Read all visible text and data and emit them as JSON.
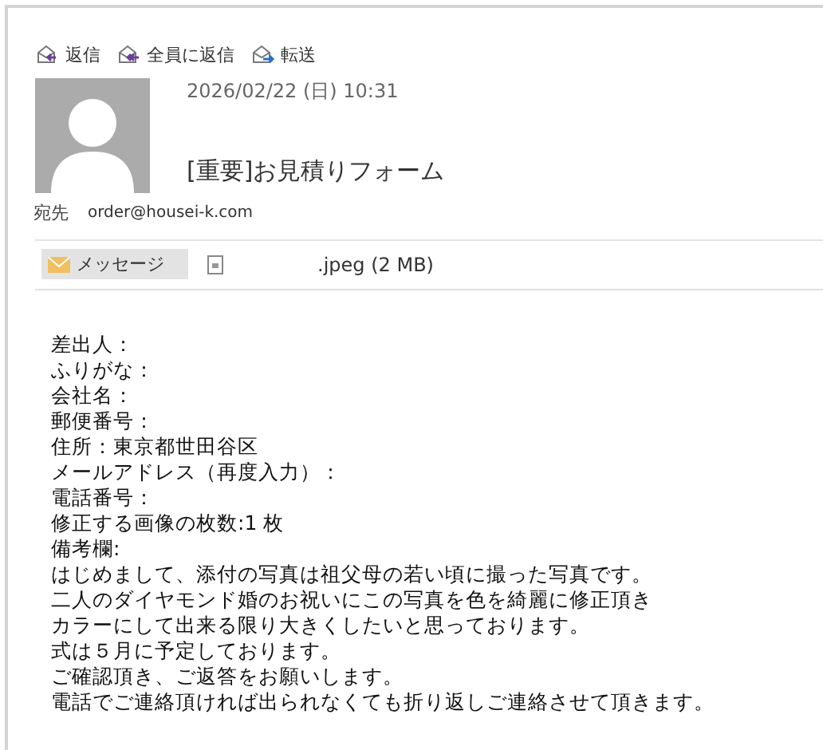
{
  "toolbar": [
    {
      "kind": "reply",
      "label": "返信"
    },
    {
      "kind": "reply_all",
      "label": "全員に返信"
    },
    {
      "kind": "forward",
      "label": "転送"
    }
  ],
  "header": {
    "date": "2026/02/22 (日) 10:31",
    "subject": "[重要]お見積りフォーム",
    "to_label": "宛先",
    "to": "order@housei-k.com"
  },
  "attachments": [
    {
      "kind": "message",
      "label": "メッセージ",
      "selected": true
    },
    {
      "kind": "file",
      "label": ".jpeg (2 MB)",
      "selected": false
    }
  ],
  "body": [
    "差出人：",
    "ふりがな：",
    "会社名：",
    "郵便番号：",
    "住所：東京都世田谷区",
    "メールアドレス（再度入力）：",
    "電話番号：",
    "修正する画像の枚数:1 枚",
    "備考欄:",
    "はじめまして、添付の写真は祖父母の若い頃に撮った写真です。",
    "二人のダイヤモンド婚のお祝いにこの写真を色を綺麗に修正頂き",
    "カラーにして出来る限り大きくしたいと思っております。",
    "式は５月に予定しております。",
    "ご確認頂き、ご返答をお願いします。",
    "電話でご連絡頂ければ出られなくても折り返しご連絡させて頂きます。"
  ]
}
